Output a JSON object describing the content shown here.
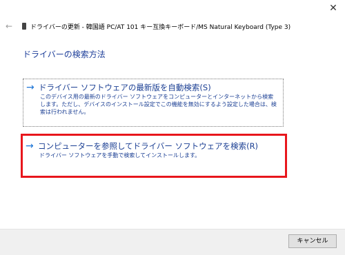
{
  "window": {
    "close_glyph": "✕",
    "back_glyph": "←",
    "title": "ドライバーの更新 - 韓国語 PC/AT 101 キー互換キーボード/MS Natural Keyboard (Type 3)",
    "device_icon": "keyboard-device-icon"
  },
  "page": {
    "heading": "ドライバーの検索方法"
  },
  "options": [
    {
      "arrow": "→",
      "title": "ドライバー ソフトウェアの最新版を自動検索(S)",
      "description": "このデバイス用の最新のドライバー ソフトウェアをコンピューターとインターネットから検索します。ただし、デバイスのインストール設定でこの機能を無効にするよう設定した場合は、検索は行われません。"
    },
    {
      "arrow": "→",
      "title": "コンピューターを参照してドライバー ソフトウェアを検索(R)",
      "description": "ドライバー ソフトウェアを手動で検索してインストールします。"
    }
  ],
  "footer": {
    "cancel_label": "キャンセル"
  },
  "colors": {
    "link": "#1a3e93",
    "arrow": "#1a73d6",
    "highlight": "#e8161c",
    "footer_bg": "#f0f0f0"
  }
}
